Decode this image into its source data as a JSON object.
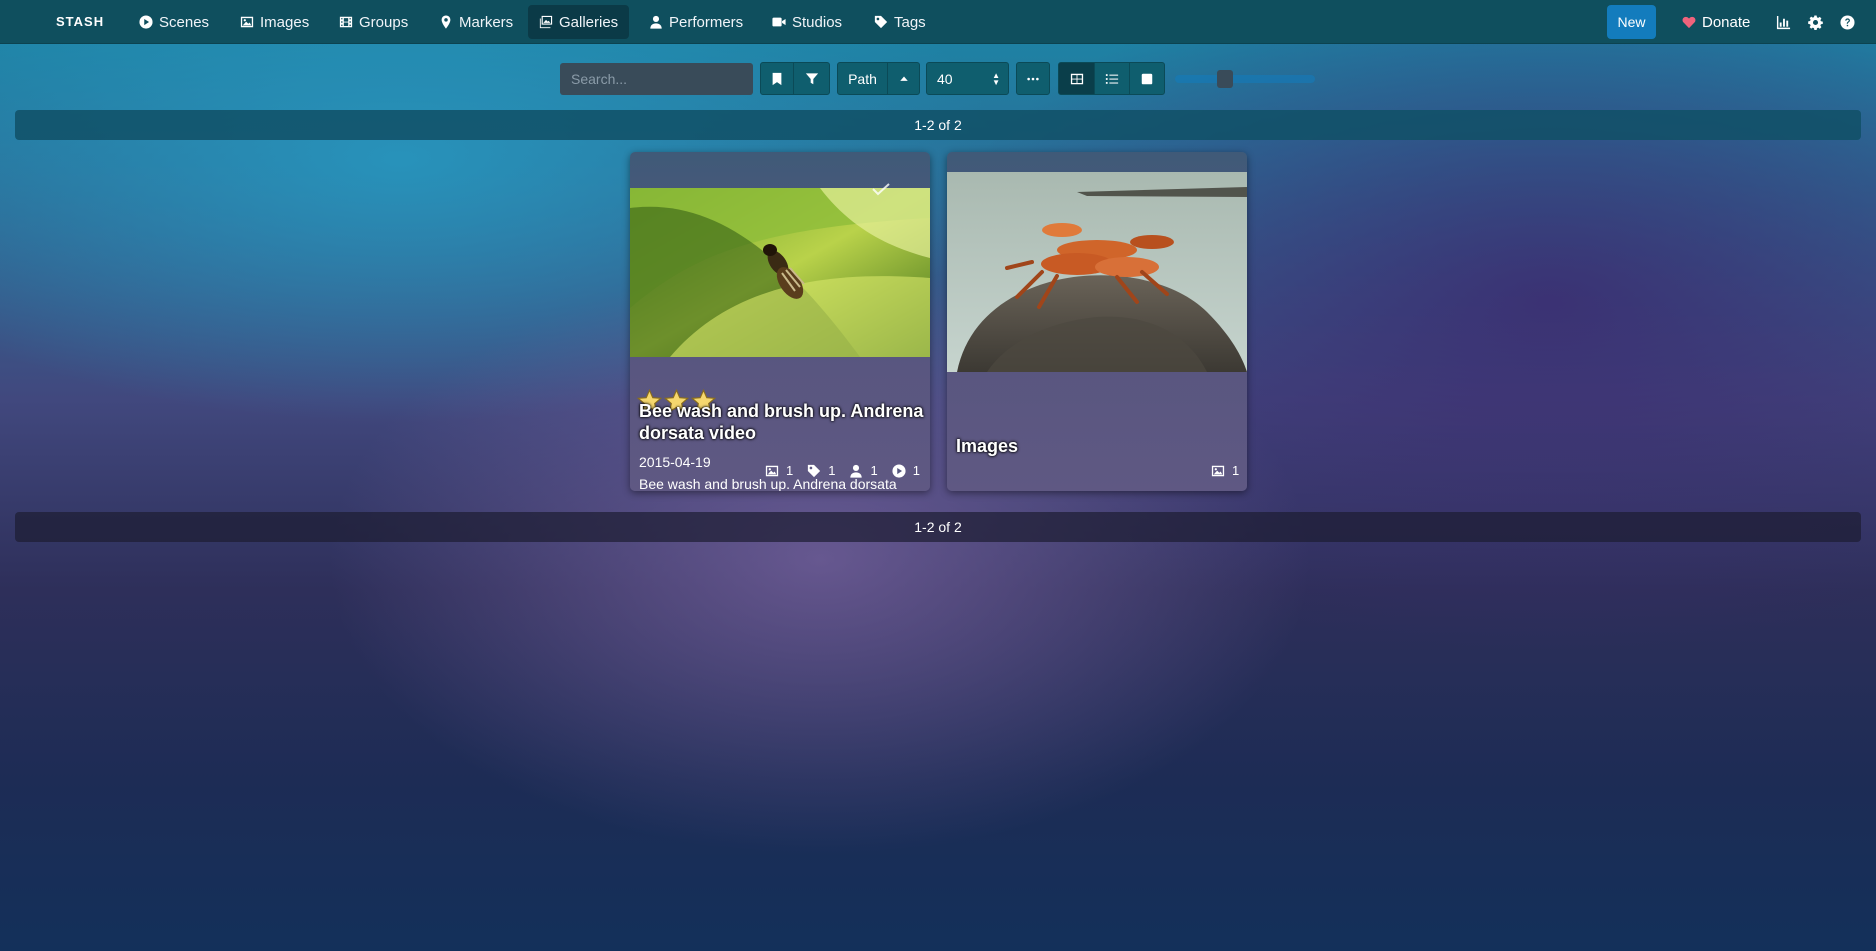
{
  "app": {
    "brand": "STASH"
  },
  "nav": {
    "items": [
      {
        "label": "Scenes",
        "icon": "play-circle-icon"
      },
      {
        "label": "Images",
        "icon": "image-icon"
      },
      {
        "label": "Groups",
        "icon": "film-icon"
      },
      {
        "label": "Markers",
        "icon": "map-marker-icon"
      },
      {
        "label": "Galleries",
        "icon": "images-icon",
        "active": true
      },
      {
        "label": "Performers",
        "icon": "user-icon"
      },
      {
        "label": "Studios",
        "icon": "video-icon"
      },
      {
        "label": "Tags",
        "icon": "tag-icon"
      }
    ],
    "new_label": "New",
    "donate_label": "Donate"
  },
  "toolbar": {
    "search_placeholder": "Search...",
    "sort_label": "Path",
    "per_page": "40",
    "zoom_level_fraction": 0.25
  },
  "pagination": {
    "label": "1-2 of 2"
  },
  "galleries": [
    {
      "title": "Bee wash and brush up. Andrena dorsata video",
      "rating": 3,
      "date": "2015-04-19",
      "description": "Bee wash and brush up. Andrena dorsata",
      "counts": {
        "images": "1",
        "tags": "1",
        "performers": "1",
        "scenes": "1"
      }
    },
    {
      "title": "Images",
      "counts": {
        "images": "1"
      }
    }
  ],
  "colors": {
    "navbar": "#0f4f5e",
    "primary": "#137cbd",
    "star": "#f5d76e",
    "heart": "#f0637c"
  }
}
